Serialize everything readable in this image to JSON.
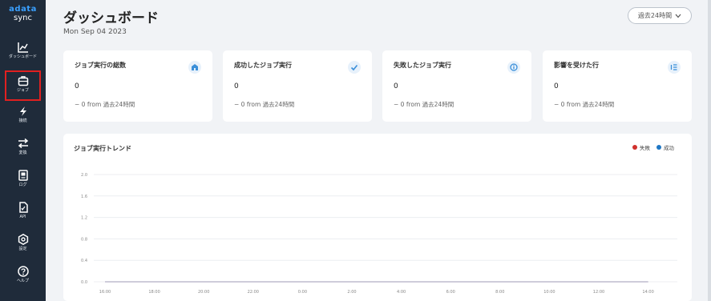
{
  "app": {
    "brand": "adata",
    "product": "sync"
  },
  "sidebar": {
    "items": [
      {
        "label": "ダッシュボード",
        "icon": "dashboard-chart-icon"
      },
      {
        "label": "ジョブ",
        "icon": "job-icon",
        "selected": true
      },
      {
        "label": "接続",
        "icon": "connection-icon"
      },
      {
        "label": "変換",
        "icon": "transform-icon"
      },
      {
        "label": "ログ",
        "icon": "log-icon"
      },
      {
        "label": "API",
        "icon": "api-icon"
      },
      {
        "label": "設定",
        "icon": "settings-icon"
      },
      {
        "label": "ヘルプ",
        "icon": "help-icon"
      }
    ]
  },
  "header": {
    "title": "ダッシュボード",
    "date": "Mon Sep 04 2023"
  },
  "range_selector": {
    "label": "過去24時間"
  },
  "cards": [
    {
      "title": "ジョブ実行の総数",
      "value": "0",
      "delta": "− 0 from 過去24時間",
      "icon": "building-icon"
    },
    {
      "title": "成功したジョブ実行",
      "value": "0",
      "delta": "− 0 from 過去24時間",
      "icon": "check-icon"
    },
    {
      "title": "失敗したジョブ実行",
      "value": "0",
      "delta": "− 0 from 過去24時間",
      "icon": "info-icon"
    },
    {
      "title": "影響を受けた行",
      "value": "0",
      "delta": "− 0 from 過去24時間",
      "icon": "list-icon"
    }
  ],
  "chart": {
    "title": "ジョブ実行トレンド",
    "legend": [
      {
        "name": "失敗",
        "color": "#d0312d"
      },
      {
        "name": "成功",
        "color": "#1f77c4"
      }
    ]
  },
  "chart_data": {
    "type": "line",
    "title": "ジョブ実行トレンド",
    "xlabel": "",
    "ylabel": "",
    "ylim": [
      0,
      2.0
    ],
    "yticks": [
      "0.0",
      "0.4",
      "0.8",
      "1.2",
      "1.6",
      "2.0"
    ],
    "categories": [
      "16:00",
      "18:00",
      "20:00",
      "22:00",
      "0:00",
      "2:00",
      "4:00",
      "6:00",
      "8:00",
      "10:00",
      "12:00",
      "14:00"
    ],
    "series": [
      {
        "name": "失敗",
        "color": "#d0312d",
        "values": [
          0,
          0,
          0,
          0,
          0,
          0,
          0,
          0,
          0,
          0,
          0,
          0
        ]
      },
      {
        "name": "成功",
        "color": "#1f77c4",
        "values": [
          0,
          0,
          0,
          0,
          0,
          0,
          0,
          0,
          0,
          0,
          0,
          0
        ]
      }
    ],
    "grid": true,
    "legend_position": "top-right"
  }
}
